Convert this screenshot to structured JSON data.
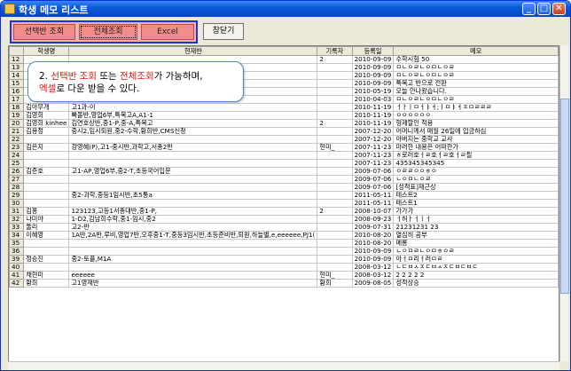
{
  "window": {
    "title": "학생 메모 리스트"
  },
  "toolbar": {
    "select_label": "선택반 조회",
    "all_label": "전체조회",
    "excel_label": "Excel",
    "close_label": "창닫기"
  },
  "grid": {
    "headers": [
      "",
      "학생명",
      "현재반",
      "기록자",
      "등록일",
      "메모"
    ],
    "rows": [
      {
        "n": "12",
        "name": "",
        "cls": "",
        "rec": "2",
        "date": "2010-09-09",
        "memo": "수학시험 50"
      },
      {
        "n": "13",
        "name": "",
        "cls": "",
        "rec": "",
        "date": "2010-09-09",
        "memo": "ㅁㄴㅇㄹㄴㅇㅁㄴㅇㄹ"
      },
      {
        "n": "14",
        "name": "",
        "cls": "",
        "rec": "",
        "date": "2010-09-09",
        "memo": "ㅁㄴㅇㄹㄴㅇㅁㄴㅇㄹ"
      },
      {
        "n": "15",
        "name": "",
        "cls": "",
        "rec": "",
        "date": "2010-09-09",
        "memo": "특목고 반으로 전환"
      },
      {
        "n": "16",
        "name": "",
        "cls": "",
        "rec": "",
        "date": "2010-05-19",
        "memo": "오늘 안나왔습니다."
      },
      {
        "n": "17",
        "name": "",
        "cls": "",
        "rec": "",
        "date": "2010-04-03",
        "memo": "ㅁㄴㅇㄹㄴㅇㅁㄴㅇㄹ"
      },
      {
        "n": "18",
        "name": "김아무개",
        "cls": "고1과-이",
        "rec": "",
        "date": "2010-11-19",
        "memo": "ㅓㅏㅣㅁㅓㅑㅕ;ㅣㅁㅑㅕㅈㅁㄹㄹㄹ"
      },
      {
        "n": "19",
        "name": "김영희",
        "cls": "빠볼반,영업6부,특목고A,A1-1",
        "rec": "",
        "date": "2010-11-19",
        "memo": "ㅇㅇㅇㅇㅇㅇ"
      },
      {
        "n": "20",
        "name": "김영희 kinhee",
        "cls": "김연호상반,중1-P,중-A,특목고",
        "rec": "2",
        "date": "2010-11-19",
        "memo": "형제할인 적용"
      },
      {
        "n": "21",
        "name": "김용정",
        "cls": "중시2,임시퇴원,중2-수학,황희반,CMS신청",
        "rec": "",
        "date": "2007-12-20",
        "memo": "어머니께서 매월 26일에 입금하심"
      },
      {
        "n": "22",
        "name": "",
        "cls": "",
        "rec": "",
        "date": "2007-12-20",
        "memo": "아버지는 중학교 교사"
      },
      {
        "n": "23",
        "name": "김은지",
        "cls": "강영혜(P),고1-중시반,과학고,서총2반",
        "rec": "현미_",
        "date": "2007-11-23",
        "memo": "마러한 내용은 어떠한가"
      },
      {
        "n": "24",
        "name": "",
        "cls": "",
        "rec": "",
        "date": "2007-11-23",
        "memo": "ㅎ로러호ㅓㄹ호ㅓㄹ호ㅓㄹ필"
      },
      {
        "n": "25",
        "name": "",
        "cls": "",
        "rec": "",
        "date": "2007-11-23",
        "memo": "435345345345"
      },
      {
        "n": "26",
        "name": "김준호",
        "cls": "고1-AP,영업6부,중2-T,초등국어입문",
        "rec": "",
        "date": "2009-07-06",
        "memo": "ㅇㄹㄹㅇㅇㅎㅇ"
      },
      {
        "n": "27",
        "name": "",
        "cls": "",
        "rec": "",
        "date": "2009-07-06",
        "memo": "ㄴㅇㅁㄴㅇㄹ"
      },
      {
        "n": "28",
        "name": "",
        "cls": "",
        "rec": "",
        "date": "2009-07-06",
        "memo": "[성적표]재근상"
      },
      {
        "n": "29",
        "name": "",
        "cls": "중2-과학,중등1임시반,초5통a",
        "rec": "",
        "date": "2011-05-11",
        "memo": "테스트2"
      },
      {
        "n": "30",
        "name": "",
        "cls": "",
        "rec": "",
        "date": "2011-05-11",
        "memo": "테스트1"
      },
      {
        "n": "31",
        "name": "김홍",
        "cls": "123123,고등1서총대반,중1-P,",
        "rec": "2",
        "date": "2008-10-07",
        "memo": "가가가"
      },
      {
        "n": "32",
        "name": "나미야",
        "cls": "1-D2,김남희수학,중1-임시,중2",
        "rec": "",
        "date": "2008-09-23",
        "memo": "ㅓ허ㅏㅓㅣㅓ"
      },
      {
        "n": "33",
        "name": "둘리",
        "cls": "고2-반",
        "rec": "",
        "date": "2009-07-31",
        "memo": "21231231 23"
      },
      {
        "n": "34",
        "name": "이혜영",
        "cls": "1A반,2A반,루비,영업7반,오후중1-T,중등3임시반,초등준비반,퇴원,하늘별,e,eeeeee,PJ1(",
        "rec": "",
        "date": "2010-08-20",
        "memo": "열심히 공부"
      },
      {
        "n": "35",
        "name": "",
        "cls": "",
        "rec": "",
        "date": "2010-08-20",
        "memo": "메롱"
      },
      {
        "n": "36",
        "name": "",
        "cls": "",
        "rec": "",
        "date": "2010-09-09",
        "memo": "ㄴㅇㅁㄹㄴㅇㅁㅎㅇㄹ"
      },
      {
        "n": "39",
        "name": "정승진",
        "cls": "중2-토플,M1A",
        "rec": "",
        "date": "2010-09-09",
        "memo": "아ㅓㅁ리ㅓ러ㅁㄹ"
      },
      {
        "n": "40",
        "name": "",
        "cls": "",
        "rec": "",
        "date": "2008-03-12",
        "memo": "ㄴㄷㅂㅅㅈㄷㅂㅅㅈㄷㅂㄷㅂㄷ"
      },
      {
        "n": "41",
        "name": "채현미",
        "cls": "eeeeee",
        "rec": "현미_",
        "date": "2008-03-12",
        "memo": "2 2 2 2 2"
      },
      {
        "n": "42",
        "name": "황희",
        "cls": "고1영재반",
        "rec": "황희",
        "date": "2009-08-05",
        "memo": "성적상승"
      }
    ]
  },
  "callout": {
    "prefix": "2. ",
    "hl1": "선택반 조회",
    "mid1": " 또는 ",
    "hl2": "전체조회",
    "mid2": "가 가능하며,",
    "hl3": "엑셀",
    "suffix": "로 다운 받을 수 있다."
  }
}
